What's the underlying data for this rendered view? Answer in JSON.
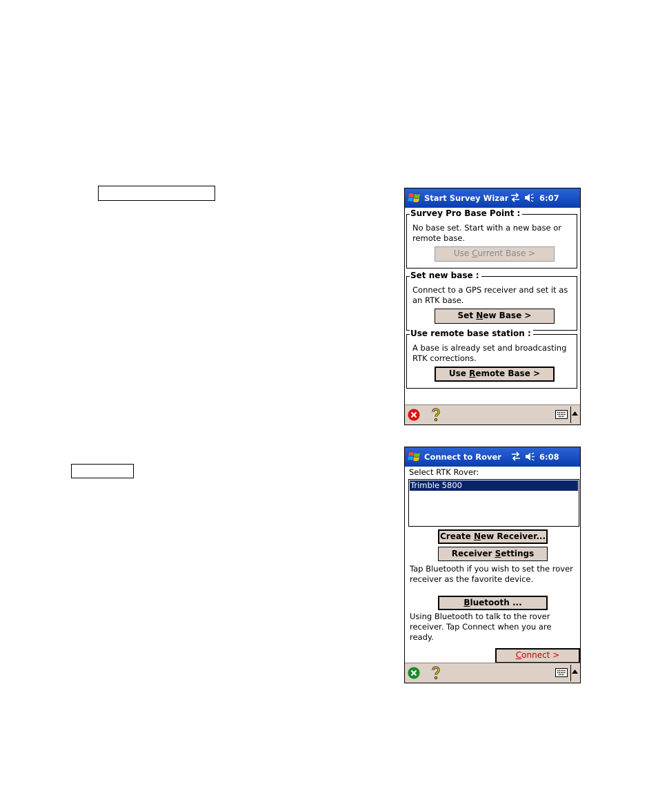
{
  "screen1": {
    "title": "Start Survey Wizard",
    "clock": "6:07",
    "groups": [
      {
        "title": "Survey Pro Base Point :",
        "text": "No base set. Start with a new base or remote base.",
        "button_pre": "Use ",
        "button_key": "C",
        "button_post": "urrent Base >"
      },
      {
        "title": "Set new base :",
        "text": "Connect to a GPS receiver and set it as an RTK base.",
        "button_pre": "Set ",
        "button_key": "N",
        "button_post": "ew Base >"
      },
      {
        "title": "Use remote base station :",
        "text": "A base is already set and broadcasting RTK corrections.",
        "button_pre": "Use ",
        "button_key": "R",
        "button_post": "emote Base >"
      }
    ]
  },
  "screen2": {
    "title": "Connect to Rover",
    "clock": "6:08",
    "select_label": "Select RTK Rover:",
    "rover_items": [
      "Trimble 5800"
    ],
    "create_btn": {
      "pre": "Create ",
      "key": "N",
      "post": "ew Receiver..."
    },
    "settings_btn": {
      "pre": "Receiver ",
      "key": "S",
      "post": "ettings"
    },
    "bluetooth_hint": "Tap Bluetooth if you wish to set the rover  receiver as the favorite device.",
    "bluetooth_btn": {
      "pre": "",
      "key": "B",
      "post": "luetooth ..."
    },
    "status_text": "Using Bluetooth to talk to the rover receiver. Tap Connect when you are ready.",
    "connect_btn": {
      "pre": "",
      "key": "C",
      "post": "onnect >"
    }
  },
  "colors": {
    "titlebar": "#0a3eb0",
    "bar": "#dcd0c7",
    "selection": "#0a246a",
    "connect_text": "#d00000"
  }
}
